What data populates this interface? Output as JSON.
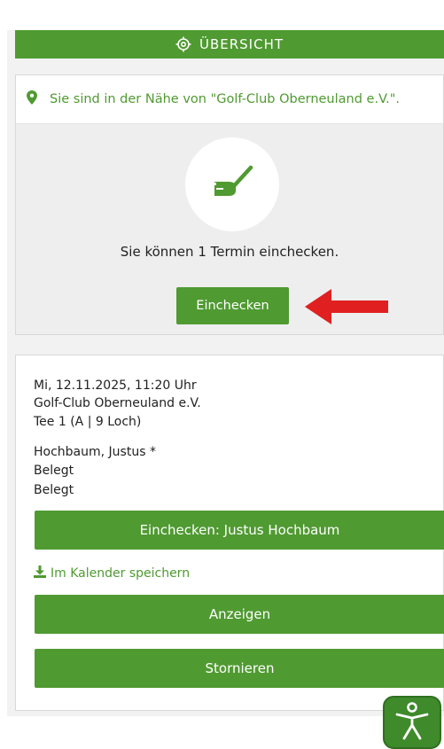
{
  "header": {
    "title": "ÜBERSICHT",
    "icon": "target-icon"
  },
  "proximity": {
    "location_text": "Sie sind in der Nähe von \"Golf-Club Oberneuland e.V.\".",
    "icon": "map-marker-icon",
    "golf_icon": "golf-club-icon",
    "message": "Sie können 1 Termin einchecken.",
    "button_label": "Einchecken"
  },
  "booking": {
    "datetime": "Mi, 12.11.2025, 11:20 Uhr",
    "club": "Golf-Club Oberneuland e.V.",
    "tee": "Tee 1 (A | 9 Loch)",
    "players": [
      "Hochbaum, Justus *",
      "Belegt",
      "Belegt"
    ],
    "checkin_button": "Einchecken: Justus Hochbaum",
    "calendar_link": "Im Kalender speichern",
    "show_button": "Anzeigen",
    "cancel_button": "Stornieren"
  },
  "colors": {
    "brand": "#4f9a31",
    "arrow": "#e02020"
  },
  "accessibility_icon": "accessibility-icon"
}
